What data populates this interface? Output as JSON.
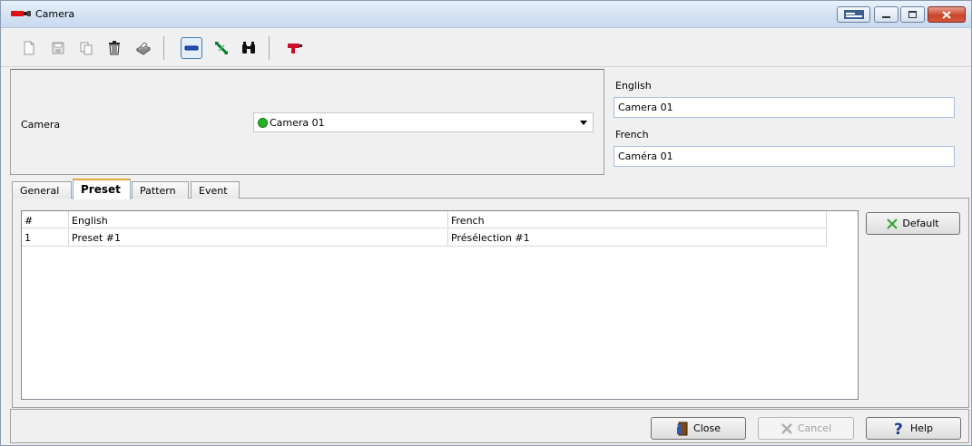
{
  "window": {
    "title": "Camera",
    "colors": {
      "close_button": "#c9452c",
      "title_gradient": "#d6e3f3"
    }
  },
  "toolbar": {
    "tools": [
      {
        "name": "new-icon"
      },
      {
        "name": "save-icon"
      },
      {
        "name": "copy-icon"
      },
      {
        "name": "delete-icon"
      },
      {
        "name": "print-icon"
      },
      {
        "name": "minus-icon"
      },
      {
        "name": "link-icon"
      },
      {
        "name": "binoculars-icon"
      },
      {
        "name": "camera-gun-icon"
      }
    ]
  },
  "camera": {
    "label": "Camera",
    "selected": "Camera 01",
    "status_color": "#21b321"
  },
  "names": {
    "english_label": "English",
    "english_value": "Camera 01",
    "french_label": "French",
    "french_value": "Caméra 01"
  },
  "tabs": [
    "General",
    "Preset",
    "Pattern",
    "Event"
  ],
  "active_tab": "Preset",
  "grid": {
    "headers": [
      "#",
      "English",
      "French"
    ],
    "rows": [
      [
        "1",
        "Preset #1",
        "Présélection #1"
      ]
    ]
  },
  "buttons": {
    "default": "Default",
    "close": "Close",
    "cancel": "Cancel",
    "help": "Help"
  }
}
